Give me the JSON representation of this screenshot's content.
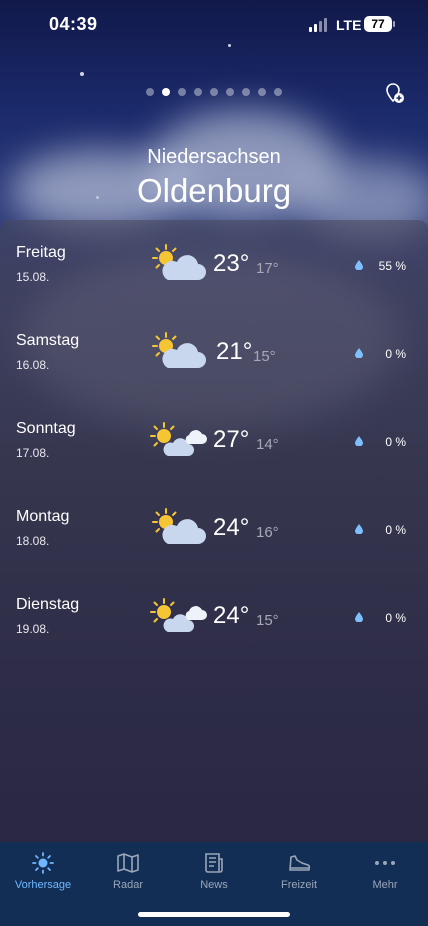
{
  "status_bar": {
    "time": "04:39",
    "network": "LTE",
    "battery": "77"
  },
  "location": {
    "region": "Niedersachsen",
    "city": "Oldenburg"
  },
  "pager": {
    "count": 9,
    "active_index": 1
  },
  "forecast": [
    {
      "day": "Freitag",
      "date": "15.08.",
      "max": "23°",
      "min": "17°",
      "precip": "55 %",
      "icon": "partly-cloudy-icon"
    },
    {
      "day": "Samstag",
      "date": "16.08.",
      "max": "21°",
      "min": "15°",
      "precip": "0 %",
      "icon": "partly-cloudy-icon"
    },
    {
      "day": "Sonntag",
      "date": "17.08.",
      "max": "27°",
      "min": "14°",
      "precip": "0 %",
      "icon": "sun-clouds-icon"
    },
    {
      "day": "Montag",
      "date": "18.08.",
      "max": "24°",
      "min": "16°",
      "precip": "0 %",
      "icon": "partly-cloudy-icon"
    },
    {
      "day": "Dienstag",
      "date": "19.08.",
      "max": "24°",
      "min": "15°",
      "precip": "0 %",
      "icon": "sun-clouds-icon"
    }
  ],
  "tabs": [
    {
      "label": "Vorhersage",
      "icon": "sun-icon",
      "active": true
    },
    {
      "label": "Radar",
      "icon": "map-icon",
      "active": false
    },
    {
      "label": "News",
      "icon": "newspaper-icon",
      "active": false
    },
    {
      "label": "Freizeit",
      "icon": "shoe-icon",
      "active": false
    },
    {
      "label": "Mehr",
      "icon": "more-icon",
      "active": false
    }
  ],
  "colors": {
    "tab_bar": "#132e55",
    "active_tab": "#6fb8ff",
    "sun": "#f5c534",
    "drop": "#7ec0ff"
  }
}
